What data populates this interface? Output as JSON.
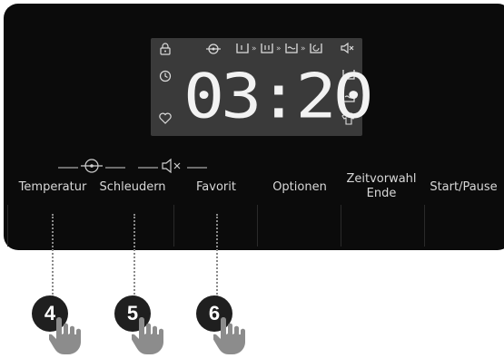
{
  "display": {
    "time": "03:20"
  },
  "buttons": [
    {
      "label": "Temperatur"
    },
    {
      "label": "Schleudern"
    },
    {
      "label": "Favorit"
    },
    {
      "label": "Optionen"
    },
    {
      "label": "Zeitvorwahl\nEnde"
    },
    {
      "label": "Start/Pause"
    }
  ],
  "callouts": [
    {
      "number": "4"
    },
    {
      "number": "5"
    },
    {
      "number": "6"
    }
  ],
  "icons": {
    "display_left": [
      "lock-icon",
      "clock-icon",
      "heart-icon"
    ],
    "display_top": [
      "temperature-icon",
      "prewash-icon",
      "wash-icon",
      "rinse-icon",
      "spin-icon",
      "mute-icon"
    ],
    "display_right": [
      "wash-icon",
      "rinse-icon",
      "shirt-icon"
    ],
    "above_buttons": [
      "temperature-icon",
      "mute-icon"
    ],
    "callout_hand": "finger-press-icon"
  },
  "colors": {
    "panel": "#0b0b0b",
    "display": "#3a3a3a",
    "display_text": "#f2f2f2",
    "badge": "#1f1f1f"
  }
}
